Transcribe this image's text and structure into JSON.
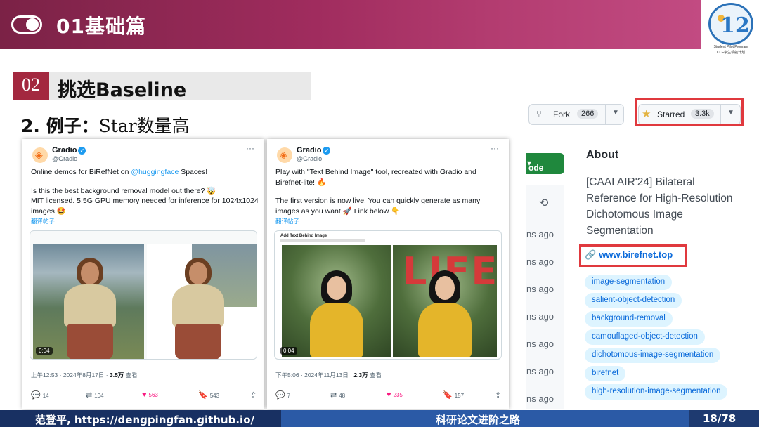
{
  "header": {
    "title": "01基础篇",
    "logo_line1": "Student Pilot Program",
    "logo_line2": "CCF学生领航计划"
  },
  "section": {
    "number": "02",
    "title": "挑选Baseline"
  },
  "example": {
    "prefix": "2. 例子：",
    "text": "Star数量高"
  },
  "tweets": [
    {
      "name": "Gradio",
      "handle": "@Gradio",
      "line1_pre": "Online demos for BiRefNet on ",
      "line1_link": "@huggingface",
      "line1_post": " Spaces!",
      "line2": "Is this the best background removal model out there? 🤯",
      "line3": "MIT licensed. 5.5G GPU memory needed for inference for 1024x1024 images.🤩",
      "translate": "翻译帖子",
      "video_time": "0:04",
      "time_pre": "上午12:53 · 2024年8月17日 · ",
      "views": "3.5万",
      "views_label": " 查看",
      "replies": "14",
      "reposts": "104",
      "likes": "563",
      "bookmarks": "543"
    },
    {
      "name": "Gradio",
      "handle": "@Gradio",
      "line1": "Play with \"Text Behind Image\" tool, recreated with Gradio and Birefnet-lite! 🔥",
      "line2": "The first version is now live. You can quickly generate as many images as you want 🚀  Link below 👇",
      "translate": "翻译帖子",
      "media_title": "Add Text Behind Image",
      "overlay_text": "LIFE",
      "video_time": "0:04",
      "time_pre": "下午5:06 · 2024年11月13日 · ",
      "views": "2.3万",
      "views_label": " 查看",
      "replies": "7",
      "reposts": "48",
      "likes": "235",
      "bookmarks": "157"
    }
  ],
  "github": {
    "fork_label": "Fork",
    "fork_count": "266",
    "star_label": "Starred",
    "star_count": "3.3k",
    "code_label": "ode",
    "ago_items": [
      "ns ago",
      "ns ago",
      "ns ago",
      "ns ago",
      "ns ago",
      "ns ago",
      "ns ago"
    ],
    "about_title": "About",
    "about_desc": "[CAAI AIR'24] Bilateral Reference for High-Resolution Dichotomous Image Segmentation",
    "website": "www.birefnet.top",
    "topics": [
      "image-segmentation",
      "salient-object-detection",
      "background-removal",
      "camouflaged-object-detection",
      "dichotomous-image-segmentation",
      "birefnet",
      "high-resolution-image-segmentation"
    ]
  },
  "footer": {
    "left": "范登平, https://dengpingfan.github.io/",
    "mid": "科研论文进阶之路",
    "page": "18/78"
  },
  "colors": {
    "accent": "#a3283f",
    "github_link": "#0969da",
    "highlight": "#e0393e",
    "footer": "#1e3a70"
  }
}
